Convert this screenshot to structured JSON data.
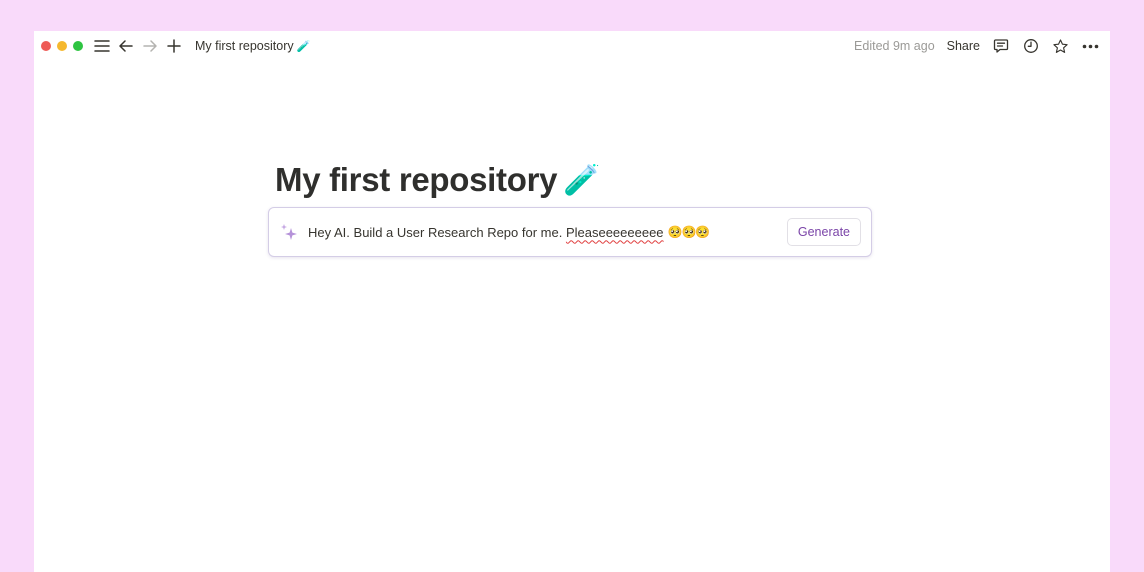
{
  "titlebar": {
    "window_controls": [
      "close",
      "minimize",
      "maximize"
    ],
    "icons": {
      "menu": "hamburger-icon",
      "back": "arrow-left-icon",
      "forward": "arrow-right-icon",
      "new": "plus-icon"
    },
    "breadcrumb": {
      "label": "My first repository",
      "emoji": "🧪"
    },
    "edited": "Edited 9m ago",
    "share_label": "Share",
    "right_icons": [
      "comment-icon",
      "clock-icon",
      "star-icon",
      "more-icon"
    ]
  },
  "page": {
    "title": "My first repository",
    "title_emoji": "🧪"
  },
  "ai_prompt": {
    "text_before": "Hey AI. Build a User Research Repo for me. ",
    "misspelled": "Pleaseeeeeeeee",
    "emojis": "🥺🥺🥺",
    "generate_label": "Generate"
  },
  "colors": {
    "background": "#f9dafa",
    "accent": "#7b45a8",
    "sparkle": "#b592d9"
  }
}
